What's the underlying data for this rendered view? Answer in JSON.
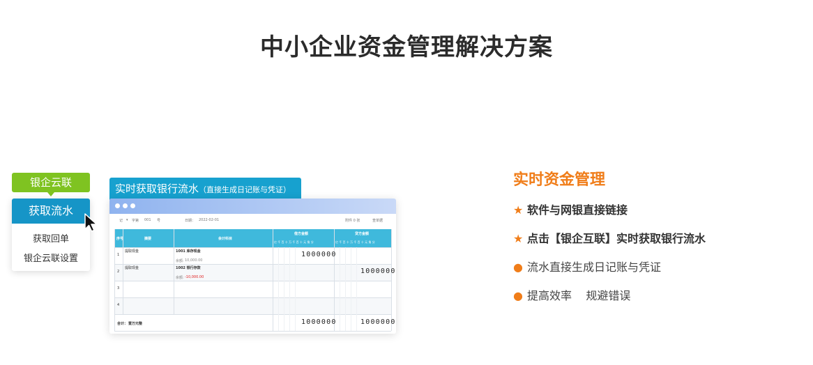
{
  "page": {
    "title": "中小企业资金管理解决方案"
  },
  "menu": {
    "tag": "银企云联",
    "active": "获取流水",
    "items": [
      "获取回单",
      "银企云联设置"
    ]
  },
  "panel": {
    "header": "实时获取银行流水",
    "header_sub": "（直接生成日记账与凭证）",
    "toolbar": {
      "voucher_type": "记",
      "word_label": "字第",
      "number": "001",
      "unit": "号",
      "date_label": "日期：",
      "date": "2022-02-01",
      "attach": "附件 0 张",
      "more": "查单据"
    },
    "columns": {
      "seq": "序号",
      "summary": "摘要",
      "account": "会计科目",
      "debit": "借方金额",
      "credit": "贷方金额",
      "units": "亿 千 百 十 万 千 百 十 元 角 分"
    },
    "rows": [
      {
        "seq": "1",
        "summary": "提取现金",
        "account": "1001 库存现金",
        "balance_label": "余额:",
        "balance": "10,000.00",
        "debit": "1000000",
        "credit": ""
      },
      {
        "seq": "2",
        "summary": "提取现金",
        "account": "1002 银行存款",
        "balance_label": "余额:",
        "balance": "-10,000.00",
        "debit": "",
        "credit": "1000000"
      },
      {
        "seq": "3",
        "summary": "",
        "account": "",
        "balance_label": "",
        "balance": "",
        "debit": "",
        "credit": ""
      },
      {
        "seq": "4",
        "summary": "",
        "account": "",
        "balance_label": "",
        "balance": "",
        "debit": "",
        "credit": ""
      }
    ],
    "total": {
      "label": "合计：",
      "words": "壹万元整",
      "debit": "1000000",
      "credit": "1000000"
    }
  },
  "features": {
    "title": "实时资金管理",
    "items": [
      {
        "marker": "★",
        "text": "软件与网银直接链接",
        "bold": true
      },
      {
        "marker": "★",
        "text": "点击【银企互联】实时获取银行流水",
        "bold": true
      },
      {
        "marker": "●",
        "text": "流水直接生成日记账与凭证",
        "bold": false
      },
      {
        "marker": "●",
        "text": "提高效率    规避错误",
        "bold": false
      }
    ]
  },
  "colors": {
    "accent": "#f07d19",
    "green": "#7fc321",
    "blue": "#1695c7",
    "header_blue": "#3fb9dc"
  }
}
